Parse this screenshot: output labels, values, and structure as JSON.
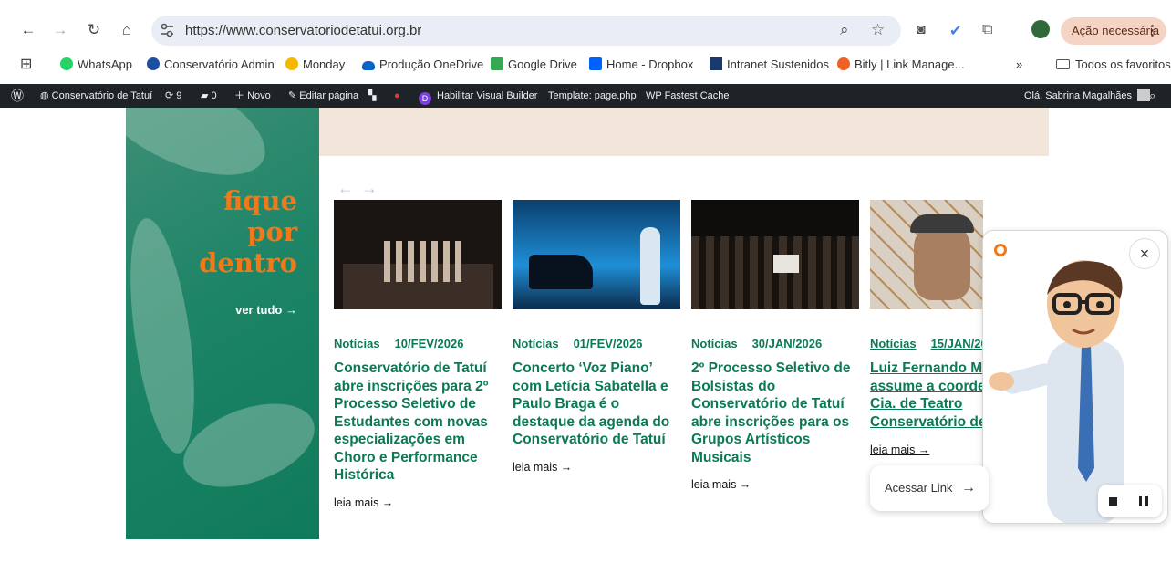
{
  "browser": {
    "url": "https://www.conservatoriodetatui.org.br",
    "action_label": "Ação necessária",
    "action_more": "⋮"
  },
  "bookmarks": {
    "items": [
      {
        "label": "WhatsApp",
        "icon": "whatsapp-icon",
        "color": "#25d366"
      },
      {
        "label": "Conservatório Admin",
        "icon": "admin-icon",
        "color": "#1d4fa3"
      },
      {
        "label": "Monday",
        "icon": "monday-icon",
        "color": "#f5b800"
      },
      {
        "label": "Produção OneDrive",
        "icon": "onedrive-icon",
        "color": "#0a64c8"
      },
      {
        "label": "Google Drive",
        "icon": "google-drive-icon",
        "color": "#34a853"
      },
      {
        "label": "Home - Dropbox",
        "icon": "dropbox-icon",
        "color": "#0061fe"
      },
      {
        "label": "Intranet Sustenidos",
        "icon": "sustenidos-icon",
        "color": "#1b3a6b"
      },
      {
        "label": "Bitly | Link Manage...",
        "icon": "bitly-icon",
        "color": "#ee6123"
      }
    ],
    "more": "»",
    "all_label": "Todos os favoritos"
  },
  "wpbar": {
    "site": "Conservatório de Tatuí",
    "updates": "9",
    "comments": "0",
    "new": "Novo",
    "edit": "Editar página",
    "builder": "Habilitar Visual Builder",
    "template": "Template: page.php",
    "cache": "WP Fastest Cache",
    "greeting": "Olá, Sabrina Magalhães"
  },
  "promo": {
    "line1": "fique",
    "line2": "por",
    "line3": "dentro",
    "link": "ver tudo →"
  },
  "carousel": {
    "prev": "←",
    "next": "→"
  },
  "news": [
    {
      "category": "Notícias",
      "date": "10/FEV/2026",
      "title": "Conservatório de Tatuí abre inscrições para 2º Processo Seletivo de Estudantes com novas especializações em Choro e Performance Histórica",
      "more": "leia mais →"
    },
    {
      "category": "Notícias",
      "date": "01/FEV/2026",
      "title": "Concerto ‘Voz Piano’ com Letícia Sabatella e Paulo Braga é o destaque da agenda do Conservatório de Tatuí",
      "more": "leia mais →"
    },
    {
      "category": "Notícias",
      "date": "30/JAN/2026",
      "title": "2º Processo Seletivo de Bolsistas do Conservatório de Tatuí abre inscrições para os Grupos Artísticos Musicais",
      "more": "leia mais →"
    },
    {
      "category": "Notícias",
      "date": "15/JAN/2026",
      "title": "Luiz Fernando Ma assume a coorde da Cia. de Teatro Conservatório de",
      "more": "leia mais →"
    }
  ],
  "widget": {
    "close": "×",
    "link_label": "Acessar Link",
    "link_arrow": "→"
  }
}
